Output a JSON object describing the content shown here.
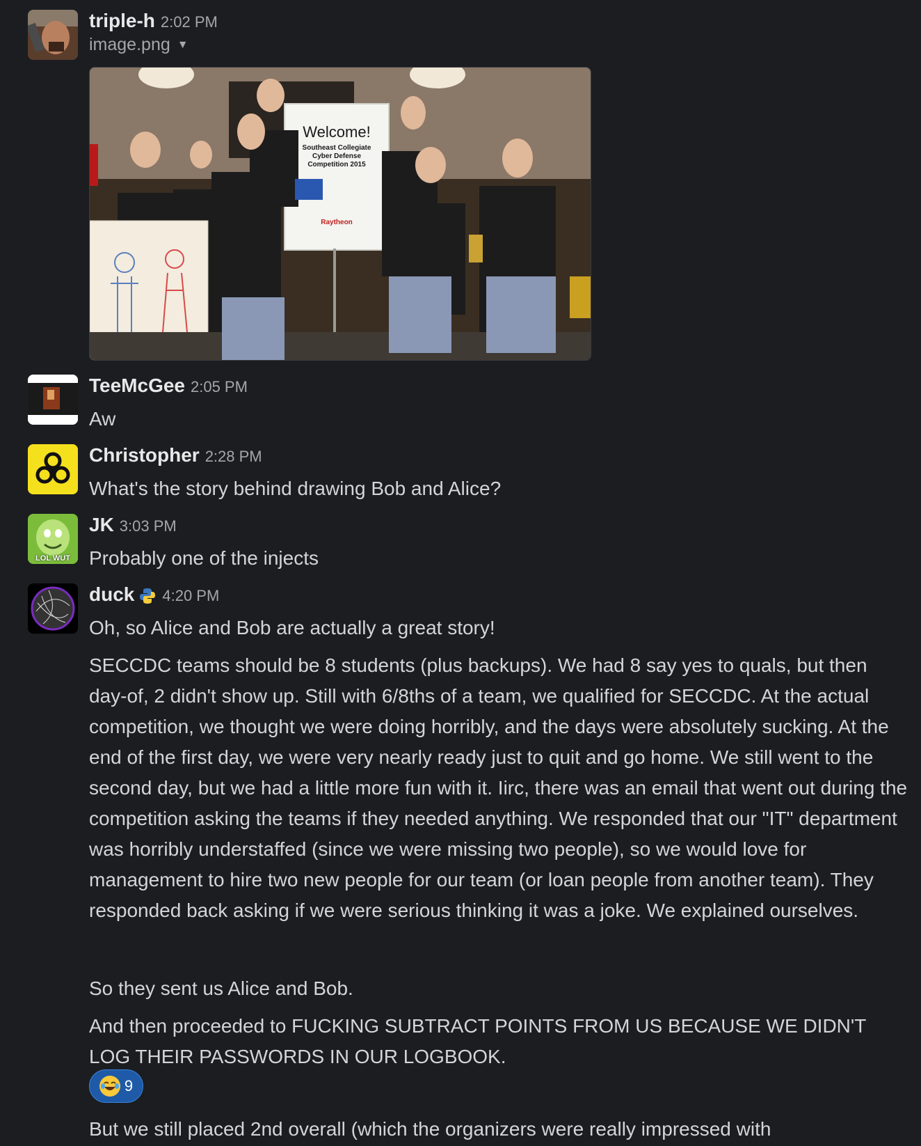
{
  "messages": [
    {
      "author": "triple-h",
      "time": "2:02 PM",
      "attachment": {
        "filename": "image.png"
      }
    },
    {
      "author": "TeeMcGee",
      "time": "2:05 PM",
      "text": "Aw"
    },
    {
      "author": "Christopher",
      "time": "2:28 PM",
      "text": "What's the story behind drawing Bob and Alice?"
    },
    {
      "author": "JK",
      "time": "3:03 PM",
      "text": "Probably one of the injects",
      "avatar_caption": "LOL WUT"
    },
    {
      "author": "duck",
      "time": "4:20 PM",
      "status_icon": "python-icon",
      "paragraphs": [
        "Oh, so Alice and Bob are actually a great story!",
        "SECCDC teams should be 8 students (plus backups). We had 8 say yes to quals, but then day-of, 2 didn't show up. Still with 6/8ths of a team, we qualified for SECCDC. At the actual competition, we thought we were doing horribly, and the days were absolutely sucking. At the end of the first day, we were very nearly ready just to quit and go home. We still went to the second day, but we had a little more fun with it. Iirc, there was an email that went out during the competition  asking the teams if they needed anything. We responded that our \"IT\" department was horribly understaffed (since we were missing two people), so we would love for management to hire two new people for our team (or loan people from another team). They responded back asking if we were serious thinking it was a joke. We explained ourselves.",
        "So they sent us Alice and Bob.",
        "And then proceeded to FUCKING SUBTRACT POINTS FROM US BECAUSE WE DIDN'T LOG THEIR PASSWORDS IN OUR LOGBOOK.",
        "But we still placed 2nd overall (which the organizers were really impressed with"
      ],
      "reaction": {
        "emoji": "joy-emoji",
        "count": "9"
      }
    }
  ],
  "photo_poster": {
    "title": "Welcome!",
    "subtitle1": "Southeast Collegiate",
    "subtitle2": "Cyber Defense",
    "subtitle3": "Competition 2015",
    "sponsor": "Raytheon"
  },
  "colors": {
    "background": "#1b1d21",
    "reaction_bg": "#1e5aa8",
    "text": "#d4d5d6",
    "muted": "#a5a6a8"
  }
}
